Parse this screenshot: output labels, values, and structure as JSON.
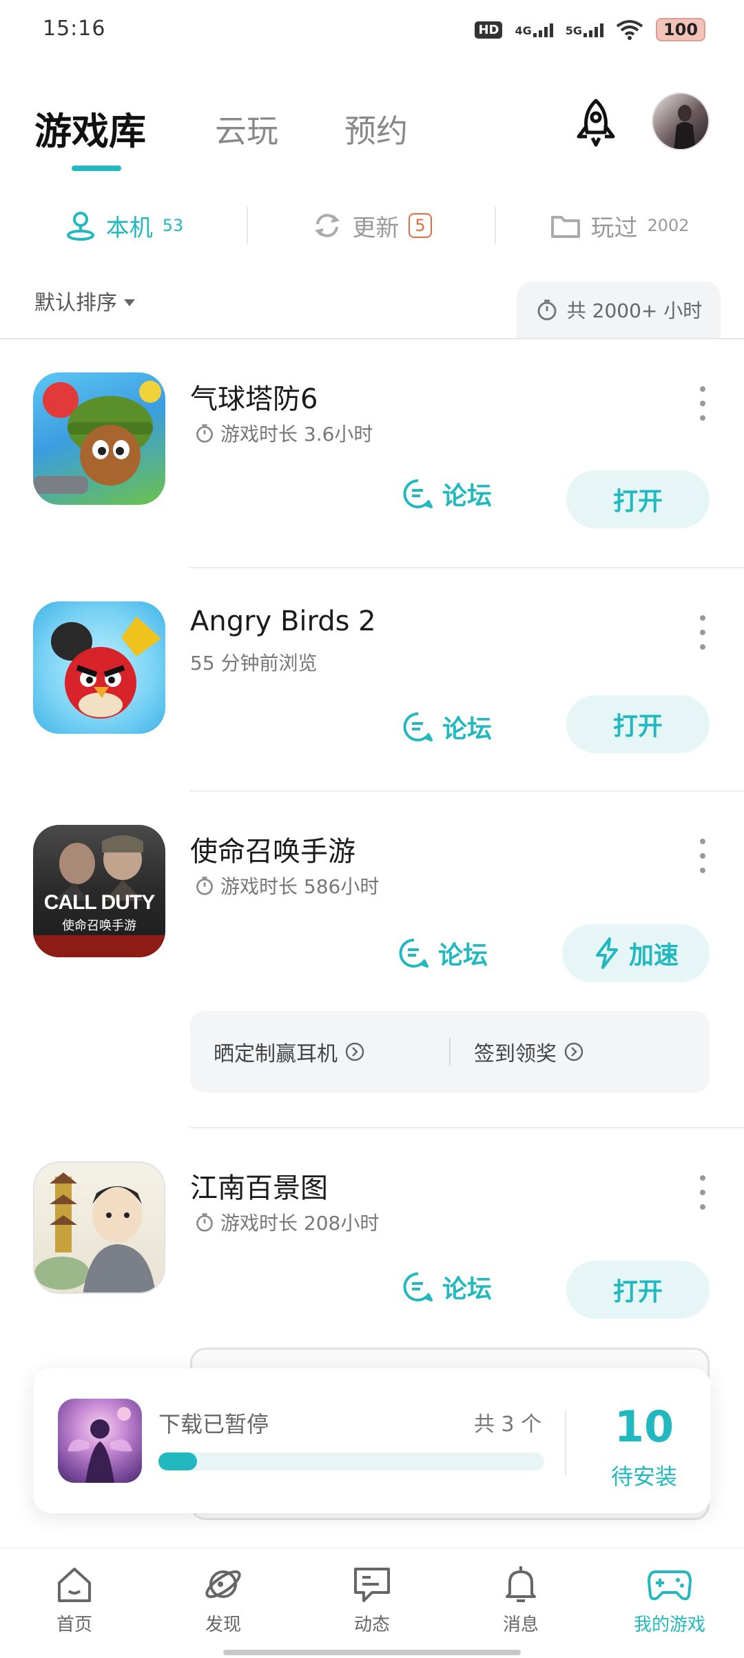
{
  "status_bar": {
    "time": "15:16",
    "hd": "HD",
    "net1": "4G",
    "net2": "5G",
    "battery": "100"
  },
  "top_tabs": [
    {
      "label": "游戏库",
      "active": true
    },
    {
      "label": "云玩",
      "active": false
    },
    {
      "label": "预约",
      "active": false
    }
  ],
  "sub_tabs": {
    "local": {
      "label": "本机",
      "count": "53"
    },
    "update": {
      "label": "更新",
      "count": "5"
    },
    "played": {
      "label": "玩过",
      "count": "2002"
    }
  },
  "sort": {
    "label": "默认排序",
    "total_time": "共 2000+ 小时"
  },
  "games": [
    {
      "title": "气球塔防6",
      "subtitle": "游戏时长 3.6小时",
      "forum": "论坛",
      "action": "打开"
    },
    {
      "title": "Angry Birds 2",
      "subtitle": "55 分钟前浏览",
      "forum": "论坛",
      "action": "打开"
    },
    {
      "title": "使命召唤手游",
      "subtitle": "游戏时长 586小时",
      "forum": "论坛",
      "action": "加速",
      "promos": [
        "晒定制赢耳机",
        "签到领奖"
      ],
      "icon_text": "CALL DUTY",
      "icon_subtext": "使命召唤手游"
    },
    {
      "title": "江南百景图",
      "subtitle": "游戏时长 208小时",
      "forum": "论坛",
      "action": "打开"
    }
  ],
  "download": {
    "status": "下载已暂停",
    "count": "共 3 个",
    "progress": 0.1,
    "pending_num": "10",
    "pending_label": "待安装"
  },
  "bottom_nav": [
    {
      "label": "首页",
      "icon": "home-icon"
    },
    {
      "label": "发现",
      "icon": "planet-icon"
    },
    {
      "label": "动态",
      "icon": "chat-icon"
    },
    {
      "label": "消息",
      "icon": "bell-icon"
    },
    {
      "label": "我的游戏",
      "icon": "gamepad-icon",
      "active": true
    }
  ],
  "colors": {
    "accent": "#22b8c0",
    "badge": "#e86a3a"
  }
}
